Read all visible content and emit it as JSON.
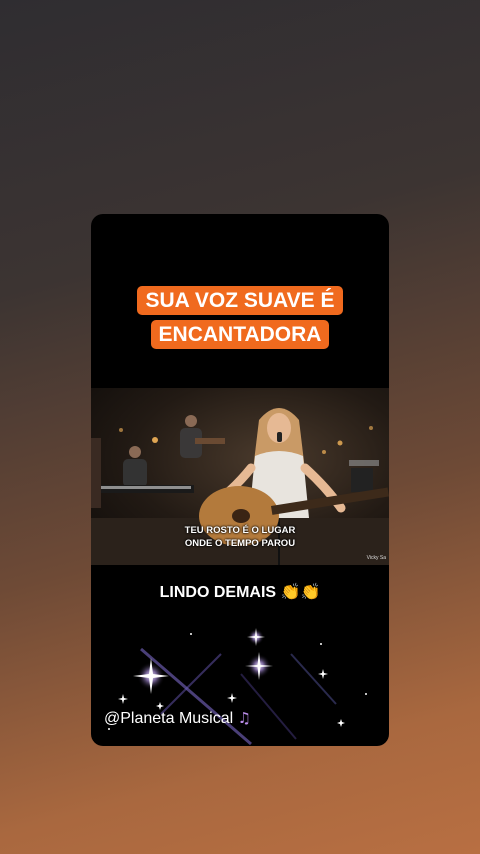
{
  "story": {
    "headline": "SUA VOZ SUAVE É ENCANTADORA",
    "video": {
      "lyric_line1": "TEU ROSTO É O LUGAR",
      "lyric_line2": "ONDE O TEMPO PAROU",
      "credit": "Vicky Sa"
    },
    "caption": "LINDO DEMAIS 👏👏",
    "handle": "@Planeta Musical",
    "handle_icon": "music-notes-icon",
    "colors": {
      "headline_highlight": "#f06a1e",
      "card_background": "#000000",
      "handle_note": "#b98ce8"
    }
  }
}
